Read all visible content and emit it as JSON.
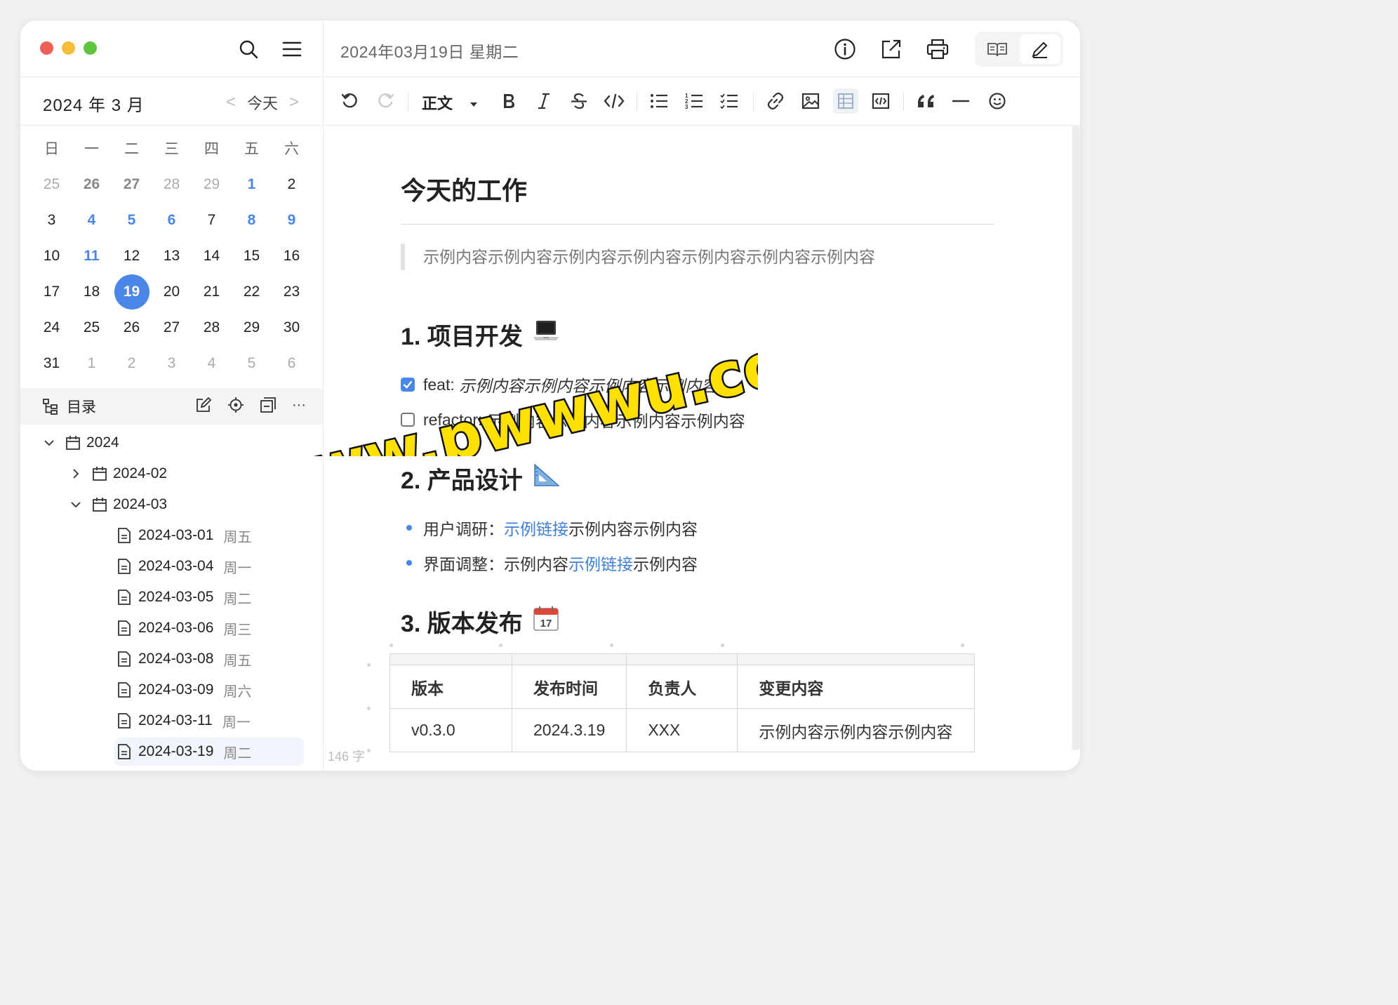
{
  "window": {
    "traffic_colors": [
      "#ee5f57",
      "#f5bd3b",
      "#5fc43f"
    ],
    "accent": "#4a86e8",
    "link_color": "#3f7fd8"
  },
  "sidebar": {
    "icons": [
      "search-icon",
      "menu-icon"
    ],
    "calendar": {
      "month_title": "2024 年 3 月",
      "today_label": "今天",
      "prev_arrow": "<",
      "next_arrow": ">",
      "weekdays": [
        "日",
        "一",
        "二",
        "三",
        "四",
        "五",
        "六"
      ],
      "weeks": [
        [
          {
            "d": "25",
            "s": "dim"
          },
          {
            "d": "26",
            "s": "dimbold"
          },
          {
            "d": "27",
            "s": "dimbold"
          },
          {
            "d": "28",
            "s": "dim"
          },
          {
            "d": "29",
            "s": "dim"
          },
          {
            "d": "1",
            "s": "blue"
          },
          {
            "d": "2",
            "s": ""
          }
        ],
        [
          {
            "d": "3",
            "s": ""
          },
          {
            "d": "4",
            "s": "blue"
          },
          {
            "d": "5",
            "s": "blue"
          },
          {
            "d": "6",
            "s": "blue"
          },
          {
            "d": "7",
            "s": ""
          },
          {
            "d": "8",
            "s": "blue"
          },
          {
            "d": "9",
            "s": "blue"
          }
        ],
        [
          {
            "d": "10",
            "s": ""
          },
          {
            "d": "11",
            "s": "blue"
          },
          {
            "d": "12",
            "s": ""
          },
          {
            "d": "13",
            "s": ""
          },
          {
            "d": "14",
            "s": ""
          },
          {
            "d": "15",
            "s": ""
          },
          {
            "d": "16",
            "s": ""
          }
        ],
        [
          {
            "d": "17",
            "s": ""
          },
          {
            "d": "18",
            "s": ""
          },
          {
            "d": "19",
            "s": "today"
          },
          {
            "d": "20",
            "s": ""
          },
          {
            "d": "21",
            "s": ""
          },
          {
            "d": "22",
            "s": ""
          },
          {
            "d": "23",
            "s": ""
          }
        ],
        [
          {
            "d": "24",
            "s": ""
          },
          {
            "d": "25",
            "s": ""
          },
          {
            "d": "26",
            "s": ""
          },
          {
            "d": "27",
            "s": ""
          },
          {
            "d": "28",
            "s": ""
          },
          {
            "d": "29",
            "s": ""
          },
          {
            "d": "30",
            "s": ""
          }
        ],
        [
          {
            "d": "31",
            "s": ""
          },
          {
            "d": "1",
            "s": "dim"
          },
          {
            "d": "2",
            "s": "dim"
          },
          {
            "d": "3",
            "s": "dim"
          },
          {
            "d": "4",
            "s": "dim"
          },
          {
            "d": "5",
            "s": "dim"
          },
          {
            "d": "6",
            "s": "dim"
          }
        ]
      ]
    },
    "toc": {
      "label": "目录",
      "tools": [
        "edit-icon",
        "locate-icon",
        "collapse-icon",
        "more-icon"
      ],
      "more_text": "···"
    },
    "tree": [
      {
        "label": "2024",
        "weekday": "",
        "kind": "folder",
        "chevron": "down"
      },
      {
        "label": "2024-02",
        "weekday": "",
        "kind": "folder",
        "chevron": "right"
      },
      {
        "label": "2024-03",
        "weekday": "",
        "kind": "folder",
        "chevron": "down"
      },
      {
        "label": "2024-03-01",
        "weekday": "周五",
        "kind": "file"
      },
      {
        "label": "2024-03-04",
        "weekday": "周一",
        "kind": "file"
      },
      {
        "label": "2024-03-05",
        "weekday": "周二",
        "kind": "file"
      },
      {
        "label": "2024-03-06",
        "weekday": "周三",
        "kind": "file"
      },
      {
        "label": "2024-03-08",
        "weekday": "周五",
        "kind": "file"
      },
      {
        "label": "2024-03-09",
        "weekday": "周六",
        "kind": "file"
      },
      {
        "label": "2024-03-11",
        "weekday": "周一",
        "kind": "file"
      },
      {
        "label": "2024-03-19",
        "weekday": "周二",
        "kind": "file",
        "selected": true
      }
    ]
  },
  "topbar": {
    "date_title": "2024年03月19日 星期二",
    "icons": [
      "info-icon",
      "export-icon",
      "print-icon",
      "read-mode-icon",
      "edit-mode-icon"
    ]
  },
  "toolbar": {
    "paragraph_style": "正文",
    "icons": [
      "undo-icon",
      "redo-icon",
      "bold-icon",
      "italic-icon",
      "strikethrough-icon",
      "code-icon",
      "bullet-list-icon",
      "ordered-list-icon",
      "task-list-icon",
      "link-icon",
      "image-icon",
      "table-icon",
      "code-block-icon",
      "quote-icon",
      "divider-icon",
      "emoji-icon"
    ]
  },
  "document": {
    "title": "今天的工作",
    "quote": "示例内容示例内容示例内容示例内容示例内容示例内容示例内容",
    "section1": {
      "heading": "1. 项目开发",
      "emoji": "💻",
      "tasks": [
        {
          "prefix": "feat: ",
          "text": "示例内容示例内容示例内容示例内容",
          "checked": true
        },
        {
          "prefix": "refactor: ",
          "text": "示例内容示例内容示例内容示例内容",
          "checked": false
        }
      ]
    },
    "section2": {
      "heading": "2. 产品设计",
      "emoji": "📐",
      "items": [
        {
          "label": "用户调研：",
          "link": "示例链接",
          "rest": "示例内容示例内容"
        },
        {
          "label": "界面调整：",
          "pre": "示例内容",
          "link": "示例链接",
          "rest": "示例内容"
        }
      ]
    },
    "section3": {
      "heading": "3. 版本发布",
      "emoji": "📆",
      "table": {
        "headers": [
          "版本",
          "发布时间",
          "负责人",
          "变更内容"
        ],
        "rows": [
          [
            "v0.3.0",
            "2024.3.19",
            "XXX",
            "示例内容示例内容示例内容"
          ]
        ]
      }
    },
    "word_count": "146 字"
  },
  "watermark": {
    "text": "www.pwwwu.com",
    "fill": "#ffe000",
    "stroke": "#111111"
  }
}
